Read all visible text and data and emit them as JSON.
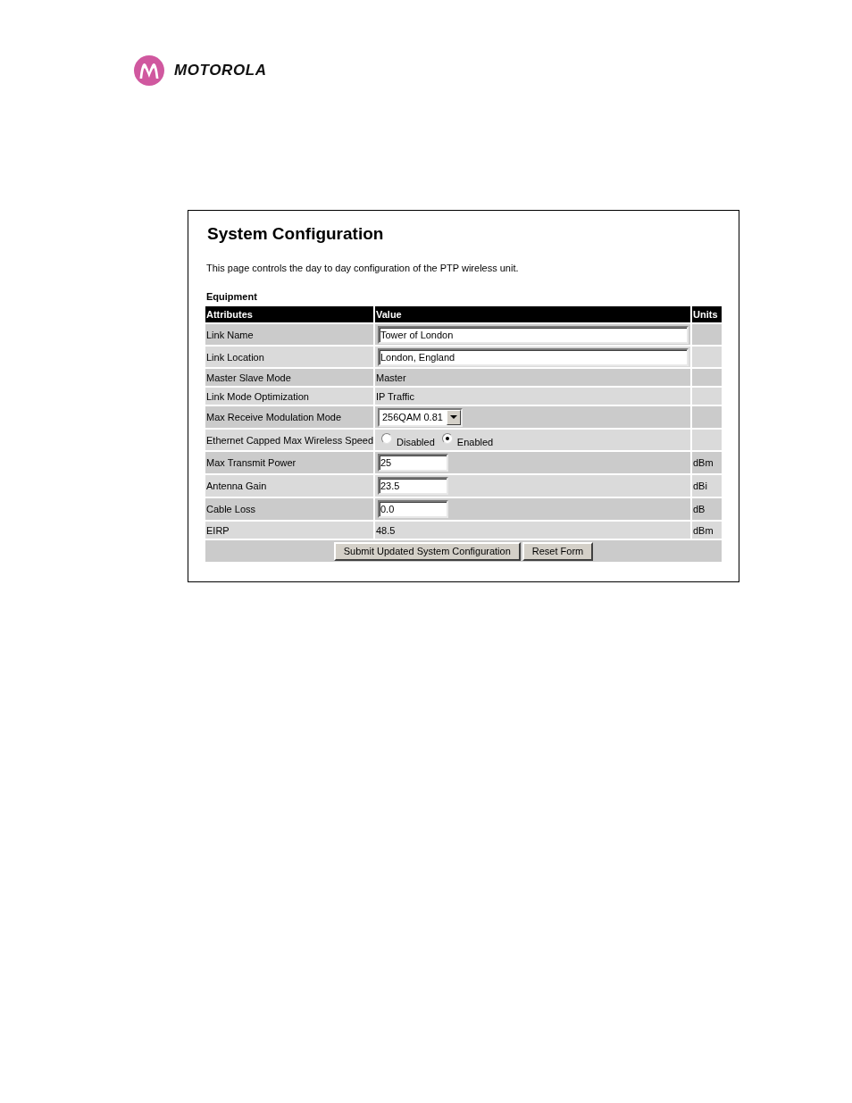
{
  "logo": {
    "wordmark": "MOTOROLA"
  },
  "panel": {
    "title": "System Configuration",
    "description": "This page controls the day to day configuration of the PTP wireless unit.",
    "section": "Equipment",
    "table": {
      "columns": [
        "Attributes",
        "Value",
        "Units"
      ],
      "rows": [
        {
          "attribute": "Link Name",
          "kind": "text",
          "value": "Tower of London"
        },
        {
          "attribute": "Link Location",
          "kind": "text",
          "value": "London, England"
        },
        {
          "attribute": "Master Slave Mode",
          "kind": "static",
          "value": "Master"
        },
        {
          "attribute": "Link Mode Optimization",
          "kind": "static",
          "value": "IP Traffic"
        },
        {
          "attribute": "Max Receive Modulation Mode",
          "kind": "select",
          "value": "256QAM 0.81"
        },
        {
          "attribute": "Ethernet Capped Max Wireless Speed",
          "kind": "radio",
          "options": [
            {
              "label": "Disabled",
              "selected": false
            },
            {
              "label": "Enabled",
              "selected": true
            }
          ]
        },
        {
          "attribute": "Max Transmit Power",
          "kind": "number",
          "value": "25",
          "units": "dBm"
        },
        {
          "attribute": "Antenna Gain",
          "kind": "number",
          "value": "23.5",
          "units": "dBi"
        },
        {
          "attribute": "Cable Loss",
          "kind": "number",
          "value": "0.0",
          "units": "dB"
        },
        {
          "attribute": "EIRP",
          "kind": "static",
          "value": "48.5",
          "units": "dBm"
        }
      ],
      "buttons": [
        "Submit Updated System Configuration",
        "Reset Form"
      ]
    }
  }
}
